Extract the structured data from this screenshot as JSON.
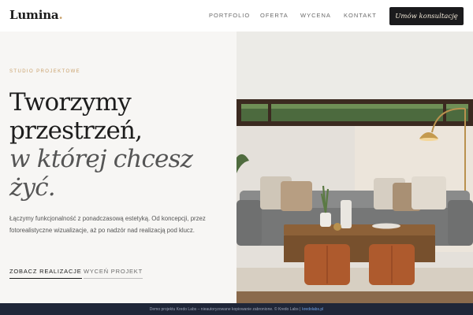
{
  "brand": {
    "name": "Lumina",
    "dot": ".",
    "accent_color": "#c9a06a"
  },
  "nav": {
    "items": [
      {
        "label": "PORTFOLIO"
      },
      {
        "label": "OFERTA"
      },
      {
        "label": "WYCENA"
      },
      {
        "label": "KONTAKT"
      }
    ],
    "cta_label": "Umów konsultację"
  },
  "hero": {
    "eyebrow": "STUDIO PROJEKTOWE",
    "headline_lines": [
      "Tworzymy",
      "przestrzeń,",
      "w której chcesz",
      "żyć."
    ],
    "description": "Łączymy funkcjonalność z ponadczasową estetyką. Od koncepcji, przez fotorealistyczne wizualizacje, aż po nadzór nad realizacją pod klucz.",
    "primary_link": "ZOBACZ REALIZACJE",
    "secondary_link": "WYCEŃ PROJEKT",
    "image_icon": "living-room-photo"
  },
  "footer": {
    "text": "Demo projektu Kredo Labs – nieautoryzowane kopiowanie zabronione. © Kredo Labs |",
    "link": "kredolabs.pl",
    "bg_color": "#1f2638"
  }
}
